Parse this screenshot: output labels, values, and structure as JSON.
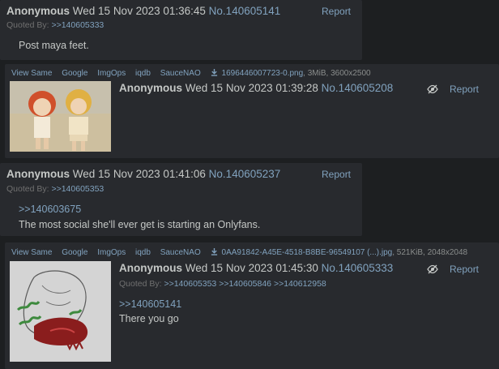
{
  "posts": [
    {
      "name": "Anonymous",
      "date": "Wed 15 Nov 2023 01:36:45",
      "no": "No.140605141",
      "report": "Report",
      "quoted_by_label": "Quoted By:",
      "quoted_by": [
        ">>140605333"
      ],
      "message_lines": [
        "Post maya feet."
      ]
    },
    {
      "name": "Anonymous",
      "date": "Wed 15 Nov 2023 01:39:28",
      "no": "No.140605208",
      "report": "Report",
      "file_links": [
        "View Same",
        "Google",
        "ImgOps",
        "iqdb",
        "SauceNAO"
      ],
      "file_name": "1696446007723-0.png",
      "file_meta": ", 3MiB, 3600x2500"
    },
    {
      "name": "Anonymous",
      "date": "Wed 15 Nov 2023 01:41:06",
      "no": "No.140605237",
      "report": "Report",
      "quoted_by_label": "Quoted By:",
      "quoted_by": [
        ">>140605353"
      ],
      "quotelink": ">>140603675",
      "message_lines": [
        "The most social she'll ever get is starting an Onlyfans."
      ]
    },
    {
      "name": "Anonymous",
      "date": "Wed 15 Nov 2023 01:45:30",
      "no": "No.140605333",
      "report": "Report",
      "file_links": [
        "View Same",
        "Google",
        "ImgOps",
        "iqdb",
        "SauceNAO"
      ],
      "file_name": "0AA91842-A45E-4518-B8BE-96549107 (...).jpg",
      "file_meta": ", 521KiB, 2048x2048",
      "quoted_by_label": "Quoted By:",
      "quoted_by": [
        ">>140605353",
        ">>140605846",
        ">>140612958"
      ],
      "quotelink": ">>140605141",
      "message_lines": [
        "There you go"
      ]
    }
  ],
  "colors": {
    "background": "#1d1f21",
    "post_bg": "#282a2e",
    "text": "#c5c8c6",
    "link": "#81a2be",
    "muted": "#707070"
  }
}
